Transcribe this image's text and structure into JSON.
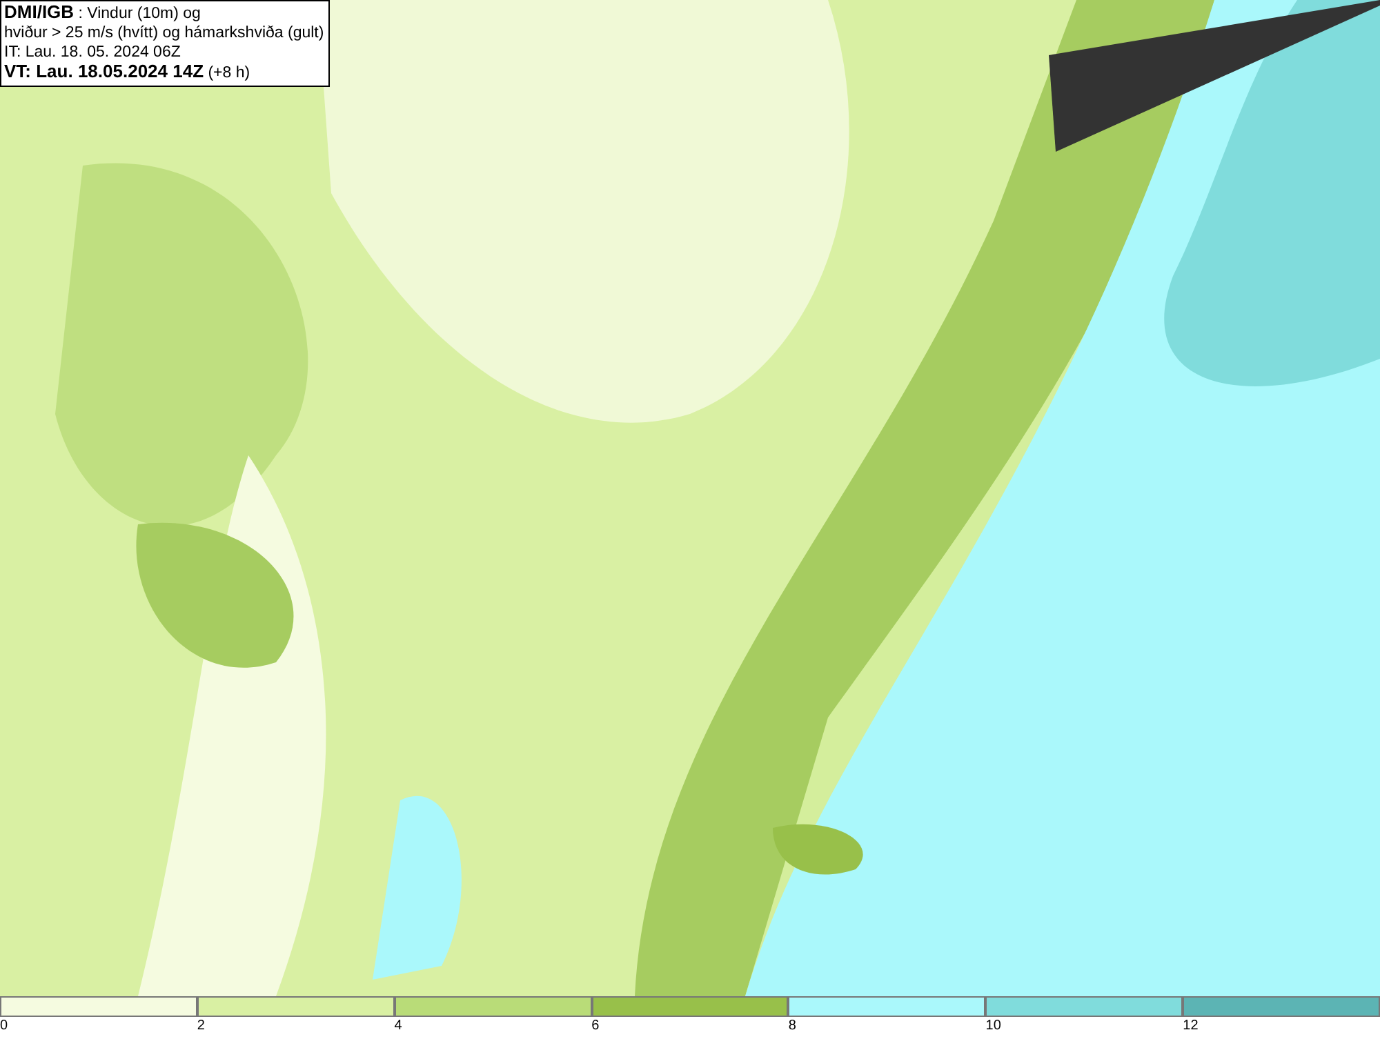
{
  "info_box": {
    "lines": [
      "**DMI/IGB** : Vindur (10m) og",
      "hviður > 25 m/s (hvítt) og hámarkshviða (gult)",
      "IT: Lau. 18. 05. 2024 06Z",
      "**VT: Lau. 18.05.2024 14Z** (+8 h)"
    ]
  },
  "legend": [
    {
      "label": "0",
      "color": "#f5fbe0"
    },
    {
      "label": "2",
      "color": "#d9f0a3"
    },
    {
      "label": "4",
      "color": "#b9dc78"
    },
    {
      "label": "6",
      "color": "#98c04a"
    },
    {
      "label": "8",
      "color": "#aaf8fb"
    },
    {
      "label": "10",
      "color": "#80dcdc"
    },
    {
      "label": "12",
      "color": "#5cb4b4"
    }
  ]
}
